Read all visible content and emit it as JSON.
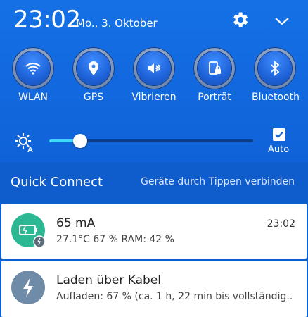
{
  "header": {
    "time": "23:02",
    "date": "Mo., 3. Oktober"
  },
  "quick_tiles": [
    {
      "label": "WLAN",
      "icon": "wifi-icon"
    },
    {
      "label": "GPS",
      "icon": "location-pin-icon"
    },
    {
      "label": "Vibrieren",
      "icon": "vibrate-icon"
    },
    {
      "label": "Porträt",
      "icon": "portrait-lock-icon"
    },
    {
      "label": "Bluetooth",
      "icon": "bluetooth-icon"
    }
  ],
  "brightness": {
    "level_fraction": 0.15,
    "auto_label": "Auto",
    "auto_checked": true
  },
  "quick_connect": {
    "title": "Quick Connect",
    "hint": "Geräte durch Tippen verbinden"
  },
  "notifications": [
    {
      "title": "65 mA",
      "subtitle": "27.1°C 67 % RAM: 42 %",
      "time": "23:02",
      "icon": "battery-icon",
      "accent": "#2db894"
    },
    {
      "title": "Laden über Kabel",
      "subtitle": "Aufladen: 67 % (ca. 1 h, 22 min bis vollständig..",
      "time": "",
      "icon": "lightning-icon",
      "accent": "#6f8ba7"
    }
  ],
  "colors": {
    "panel": "#1570e6",
    "slider_accent": "#42d7ff"
  }
}
